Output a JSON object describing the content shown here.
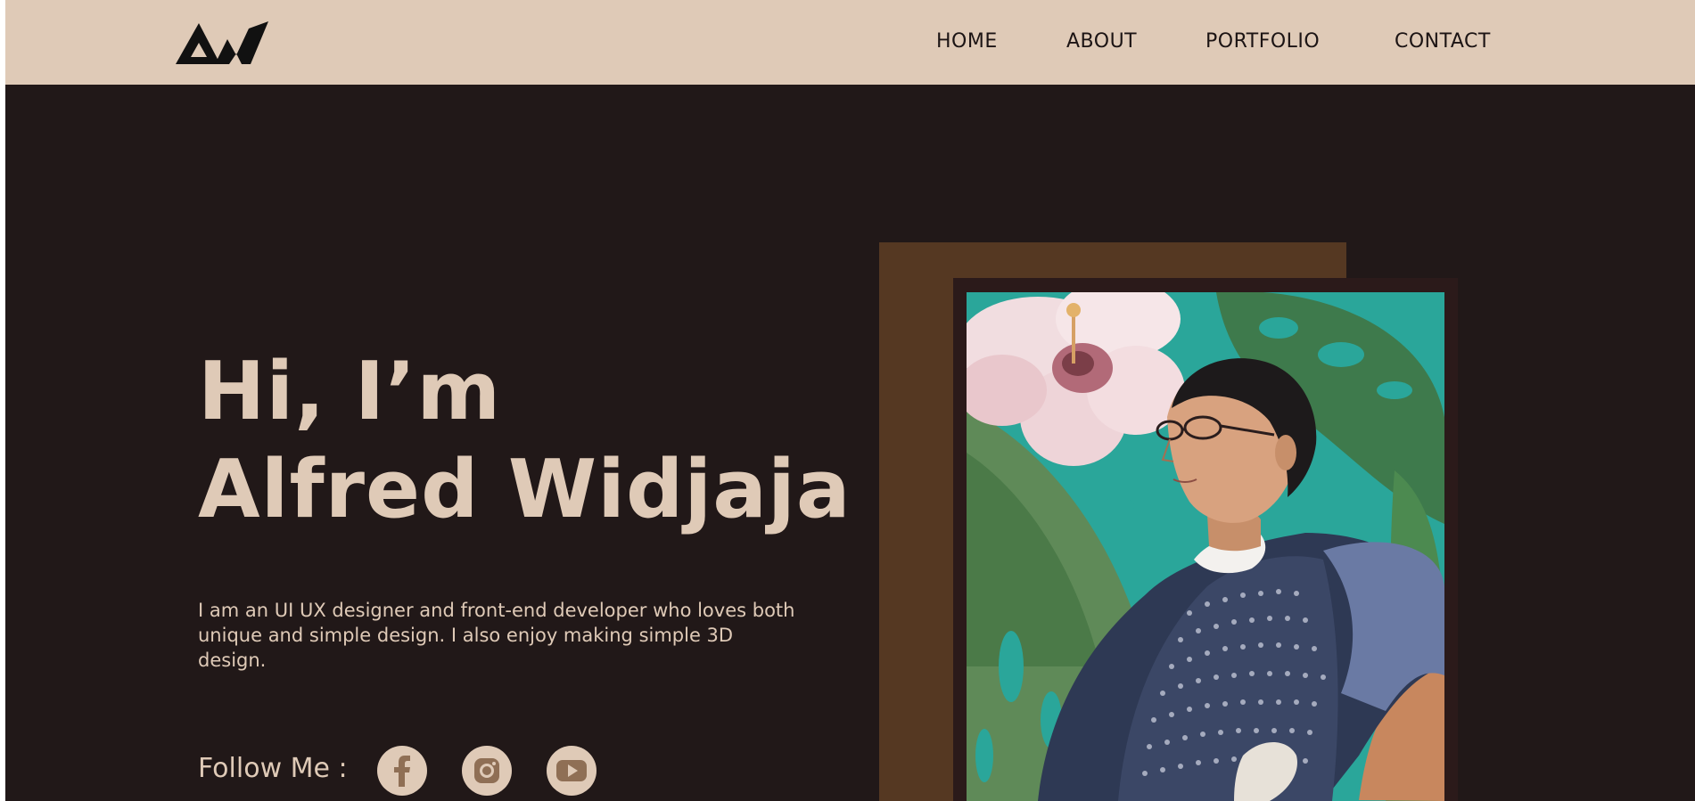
{
  "header": {
    "logo_text": "AW",
    "nav": [
      {
        "label": "HOME"
      },
      {
        "label": "ABOUT"
      },
      {
        "label": "PORTFOLIO"
      },
      {
        "label": "CONTACT"
      }
    ]
  },
  "hero": {
    "greeting": "Hi, I’m",
    "name": "Alfred Widjaja",
    "description": "I am an UI UX designer and front-end developer who loves both unique and simple design. I also enjoy making simple 3D design."
  },
  "follow": {
    "label": "Follow Me :",
    "socials": [
      {
        "icon": "facebook-icon"
      },
      {
        "icon": "instagram-icon"
      },
      {
        "icon": "youtube-icon"
      }
    ]
  },
  "colors": {
    "header_bg": "#dfcab7",
    "page_bg": "#211818",
    "accent_text": "#dfcab7",
    "photo_backdrop": "#553822",
    "photo_frame": "#2b1a1a",
    "social_icon_fg": "#8f6f55"
  }
}
